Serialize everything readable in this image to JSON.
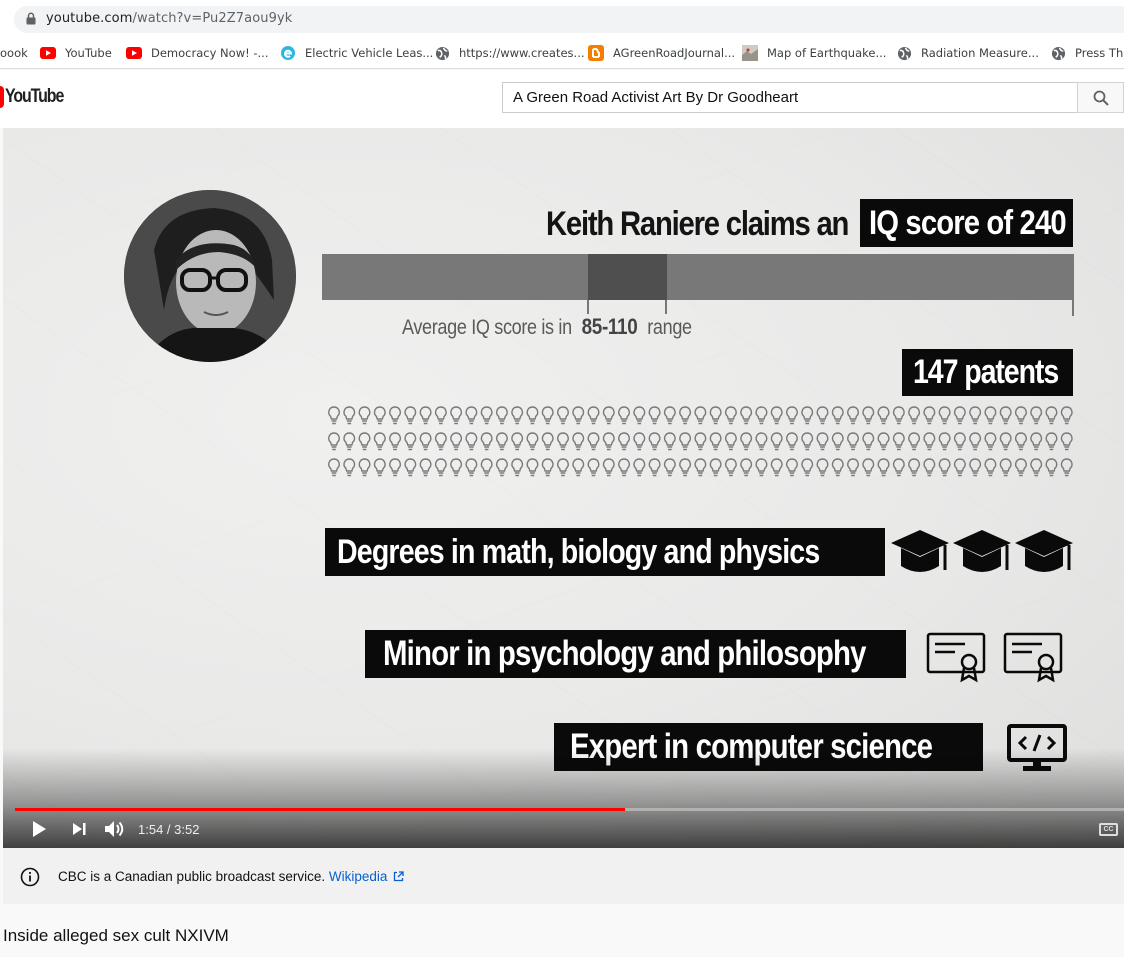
{
  "browser": {
    "url_domain": "youtube.com",
    "url_path": "/watch?v=Pu2Z7aou9yk",
    "bookmarks": [
      {
        "label": "oook",
        "icon": "facebook-icon"
      },
      {
        "label": "YouTube",
        "icon": "youtube-icon"
      },
      {
        "label": "Democracy Now! -...",
        "icon": "youtube-icon"
      },
      {
        "label": "Electric Vehicle Leas...",
        "icon": "edge-e-icon"
      },
      {
        "label": "https://www.creates...",
        "icon": "globe-icon"
      },
      {
        "label": "AGreenRoadJournal...",
        "icon": "blogger-icon"
      },
      {
        "label": "Map of Earthquake...",
        "icon": "map-icon"
      },
      {
        "label": "Radiation Measure...",
        "icon": "globe-icon"
      },
      {
        "label": "Press This",
        "icon": "globe-icon"
      }
    ]
  },
  "youtube": {
    "logo_text": "YouTube",
    "search_value": "A Green Road Activist Art By Dr Goodheart",
    "search_icon": "magnifier-icon"
  },
  "video_frame": {
    "claim_text": "Keith Raniere claims an",
    "iq_label": "IQ score of  240",
    "iq_value": 240,
    "avg_text": "Average IQ score is in",
    "avg_range": "85-110",
    "avg_suffix": "range",
    "patents_label": "147 patents",
    "degrees_label": "Degrees in math, biology and physics",
    "minor_label": "Minor in psychology and philosophy",
    "expert_label": "Expert in computer science",
    "icons": [
      "graduation-cap-icon",
      "certificate-icon",
      "computer-code-icon",
      "lightbulb-icon"
    ]
  },
  "player": {
    "time_display": "1:54 / 3:52",
    "progress_fraction": 0.55,
    "cc_label": "CC",
    "accent_color": "#ff0000"
  },
  "info": {
    "text": "CBC is a Canadian public broadcast service.",
    "link": "Wikipedia"
  },
  "video_title": "Inside alleged sex cult NXIVM"
}
